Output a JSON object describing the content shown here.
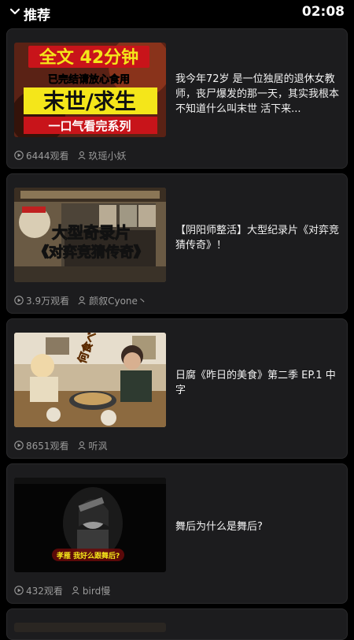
{
  "header": {
    "title": "推荐",
    "time": "02:08"
  },
  "videos": [
    {
      "thumb_text": [
        "全文 42分钟",
        "已完结请放心食用",
        "末世/求生",
        "一口气看完系列"
      ],
      "description": "我今年72岁 是一位独居的退休女教师，丧尸爆发的那一天，其实我根本不知道什么叫末世 活下来...",
      "views": "6444观看",
      "author": "玖瑶小妖"
    },
    {
      "thumb_text": [
        "大型奇录片",
        "《对弈竞猜传奇》"
      ],
      "description": "【阴阳师整活】大型纪录片《对弈竞猜传奇》！",
      "views": "3.9万观看",
      "author": "颜叙Cyone丶"
    },
    {
      "thumb_text": [
        "何食べる"
      ],
      "description": "日腐《昨日的美食》第二季 EP.1 中字",
      "views": "8651观看",
      "author": "听沨"
    },
    {
      "thumb_text": [
        "孝雁 我好么跟舞后?"
      ],
      "description": "舞后为什么是舞后?",
      "views": "432观看",
      "author": "bird慢"
    }
  ],
  "colors": {
    "background": "#000000",
    "card": "#1c1c1e",
    "meta_text": "#9a9a9a",
    "thumb1_red": "#c8141a",
    "thumb1_yellow": "#f4e61a"
  },
  "icons": {
    "header_toggle": "chevron-down-icon",
    "views": "play-circle-icon",
    "author": "person-icon"
  }
}
